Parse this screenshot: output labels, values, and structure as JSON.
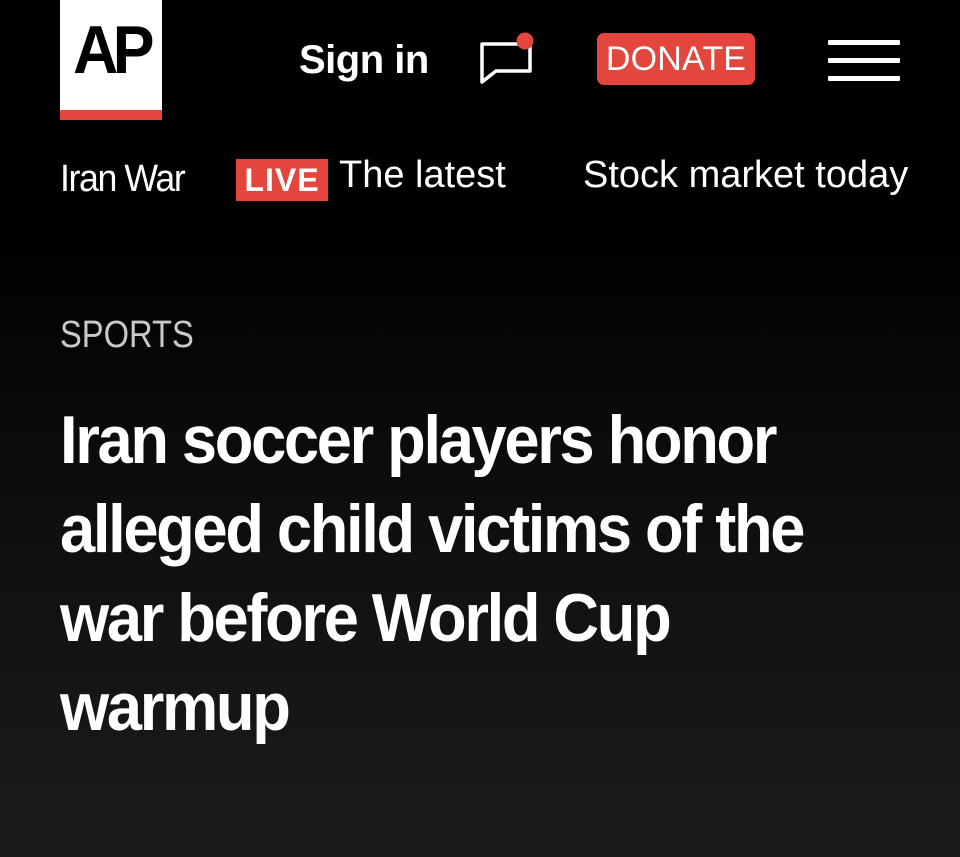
{
  "header": {
    "logo_text": "AP",
    "sign_in_label": "Sign in",
    "chat_icon": "chat-bubble-with-notification-dot",
    "donate_label": "DONATE",
    "menu_icon": "hamburger-menu"
  },
  "nav": {
    "items": [
      {
        "label": "Iran War"
      },
      {
        "badge": "LIVE",
        "label": "The latest"
      },
      {
        "label": "Stock market today"
      }
    ]
  },
  "article": {
    "section": "SPORTS",
    "headline": "Iran soccer players honor alleged child victims of the war before World Cup warmup"
  },
  "colors": {
    "background": "#000000",
    "accent_red": "#e2463c",
    "text_primary": "#ffffff",
    "text_secondary": "#c9c9c9"
  }
}
